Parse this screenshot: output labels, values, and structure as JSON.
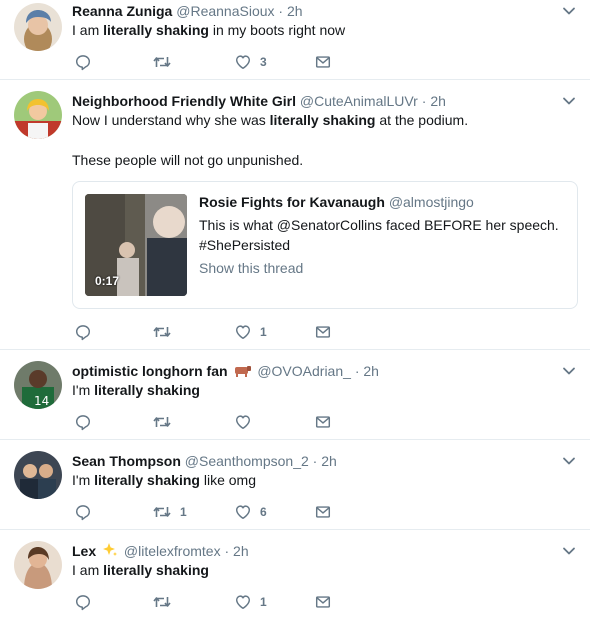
{
  "colors": {
    "text": "#14171a",
    "secondary": "#657786",
    "divider": "#e6ecf0",
    "sparkle": "#ffcc33",
    "cow": "#c1694f"
  },
  "icons": {
    "reply": "reply-icon",
    "retweet": "retweet-icon",
    "like": "heart-icon",
    "dm": "envelope-icon",
    "caret": "chevron-down-icon"
  },
  "tweets": [
    {
      "name": "Reanna Zuniga",
      "handle": "@ReannaSioux",
      "sep": "·",
      "time": "2h",
      "text": {
        "pre": "I am ",
        "bold": "literally shaking",
        "post": " in my boots right now"
      },
      "likes": "3"
    },
    {
      "name": "Neighborhood Friendly White Girl",
      "handle": "@CuteAnimalLUVr",
      "sep": "·",
      "time": "2h",
      "text": {
        "pre": "Now I understand why she was ",
        "bold": "literally shaking",
        "post": " at the podium."
      },
      "text2": "These people will not go unpunished.",
      "likes": "1",
      "quote": {
        "name": "Rosie Fights for Kavanaugh",
        "handle": "@almostjingo",
        "line1": "This is what @SenatorCollins faced BEFORE her speech.",
        "line2": "#ShePersisted",
        "show_thread": "Show this thread",
        "duration": "0:17"
      }
    },
    {
      "name": "optimistic longhorn fan",
      "emoji": "cow-emoji",
      "handle": "@OVOAdrian_",
      "sep": "·",
      "time": "2h",
      "text": {
        "pre": "I'm ",
        "bold": "literally shaking",
        "post": ""
      }
    },
    {
      "name": "Sean Thompson",
      "handle": "@Seanthompson_2",
      "sep": "·",
      "time": "2h",
      "text": {
        "pre": "I'm ",
        "bold": "literally shaking",
        "post": " like omg"
      },
      "retweets": "1",
      "likes": "6"
    },
    {
      "name": "Lex",
      "emoji": "sparkles-emoji",
      "handle": "@litelexfromtex",
      "sep": "·",
      "time": "2h",
      "text": {
        "pre": "I am ",
        "bold": "literally shaking",
        "post": ""
      },
      "likes": "1"
    }
  ]
}
